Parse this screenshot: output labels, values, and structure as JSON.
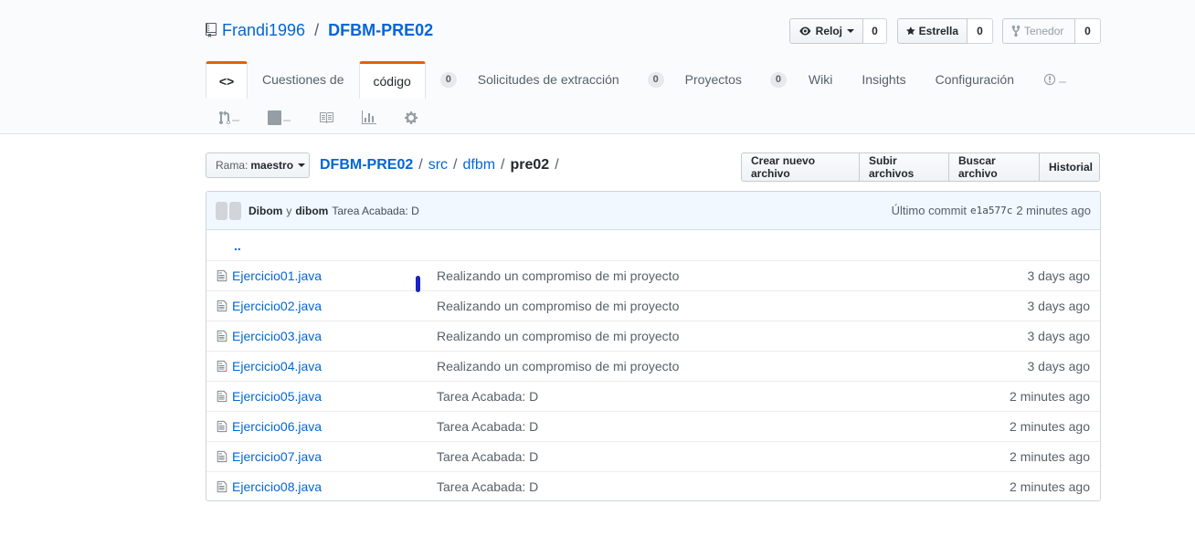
{
  "header": {
    "owner": "Frandi1996",
    "separator": "/",
    "repo": "DFBM-PRE02",
    "watch": {
      "label": "Reloj",
      "count": "0"
    },
    "star": {
      "label": "Estrella",
      "count": "0"
    },
    "fork": {
      "label": "Tenedor",
      "count": "0"
    }
  },
  "nav": {
    "code_tab": "<>",
    "issues_label": "Cuestiones de",
    "code_label": "código",
    "issues_count": "0",
    "pulls_label": "Solicitudes de extracción",
    "pulls_count": "0",
    "projects_label": "Proyectos",
    "projects_count": "0",
    "wiki_label": "Wiki",
    "insights_label": "Insights",
    "settings_label": "Configuración"
  },
  "file_nav": {
    "branch_prefix": "Rama:",
    "branch_name": "maestro",
    "breadcrumb": {
      "repo": "DFBM-PRE02",
      "dirs": [
        "src",
        "dfbm"
      ],
      "current": "pre02",
      "sep": "/"
    },
    "actions": [
      "Crear nuevo archivo",
      "Subir archivos",
      "Buscar archivo",
      "Historial"
    ]
  },
  "commit": {
    "author1": "Dibom",
    "conj": "y",
    "author2": "dibom",
    "message": "Tarea Acabada: D",
    "last_commit_label": "Último commit",
    "sha": "e1a577c",
    "time": "2 minutes ago"
  },
  "files": {
    "up_dir": "..",
    "rows": [
      {
        "name": "Ejercicio01.java",
        "message": "Realizando un compromiso de mi proyecto",
        "age": "3 days ago"
      },
      {
        "name": "Ejercicio02.java",
        "message": "Realizando un compromiso de mi proyecto",
        "age": "3 days ago"
      },
      {
        "name": "Ejercicio03.java",
        "message": "Realizando un compromiso de mi proyecto",
        "age": "3 days ago"
      },
      {
        "name": "Ejercicio04.java",
        "message": "Realizando un compromiso de mi proyecto",
        "age": "3 days ago"
      },
      {
        "name": "Ejercicio05.java",
        "message": "Tarea Acabada: D",
        "age": "2 minutes ago"
      },
      {
        "name": "Ejercicio06.java",
        "message": "Tarea Acabada: D",
        "age": "2 minutes ago"
      },
      {
        "name": "Ejercicio07.java",
        "message": "Tarea Acabada: D",
        "age": "2 minutes ago"
      },
      {
        "name": "Ejercicio08.java",
        "message": "Tarea Acabada: D",
        "age": "2 minutes ago"
      }
    ]
  },
  "colors": {
    "accent": "#0366d6",
    "selected_tab": "#e36209",
    "commit_bg": "#f1f8ff"
  }
}
